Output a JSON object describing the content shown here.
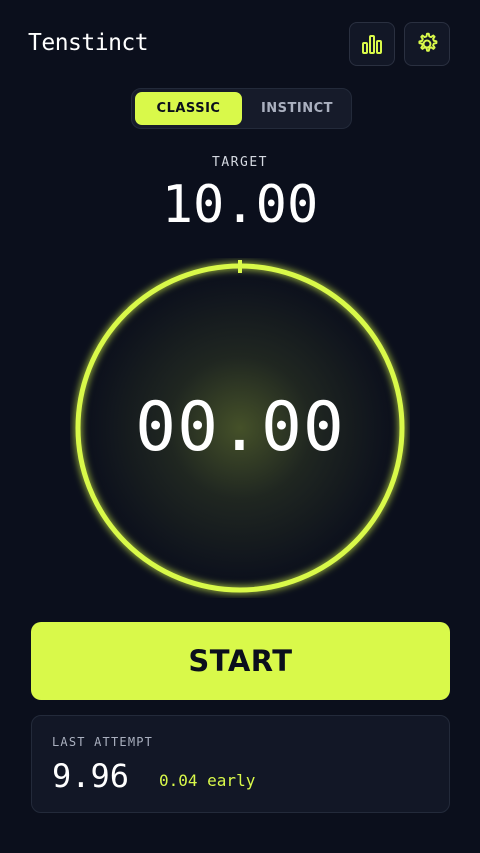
{
  "app": {
    "title": "Tenstinct"
  },
  "header": {
    "stats_icon": "bar-chart-icon",
    "settings_icon": "gear-icon"
  },
  "mode_toggle": {
    "tabs": [
      {
        "label": "CLASSIC",
        "selected": true
      },
      {
        "label": "INSTINCT",
        "selected": false
      }
    ]
  },
  "target": {
    "label": "TARGET",
    "value": "10.00"
  },
  "timer": {
    "value": "00.00"
  },
  "controls": {
    "start_label": "START"
  },
  "last_attempt": {
    "label": "LAST ATTEMPT",
    "value": "9.96",
    "delta": "0.04 early"
  },
  "colors": {
    "accent": "#d9f94a",
    "background": "#0b0f1c",
    "card": "#121726",
    "muted_text": "#aab0bf"
  }
}
